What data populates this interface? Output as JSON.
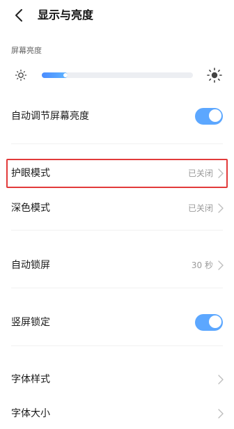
{
  "header": {
    "title": "显示与亮度"
  },
  "brightness": {
    "section_label": "屏幕亮度",
    "level_fraction": 0.17
  },
  "rows": {
    "auto_brightness": {
      "label": "自动调节屏幕亮度",
      "toggle_on": true
    },
    "eye_protection": {
      "label": "护眼模式",
      "value": "已关闭"
    },
    "dark_mode": {
      "label": "深色模式",
      "value": "已关闭"
    },
    "auto_lock": {
      "label": "自动锁屏",
      "value": "30 秒"
    },
    "portrait_lock": {
      "label": "竖屏锁定",
      "toggle_on": true
    },
    "font_style": {
      "label": "字体样式"
    },
    "font_size": {
      "label": "字体大小"
    }
  },
  "colors": {
    "accent": "#5ca7ff",
    "highlight": "#e23a3a"
  }
}
